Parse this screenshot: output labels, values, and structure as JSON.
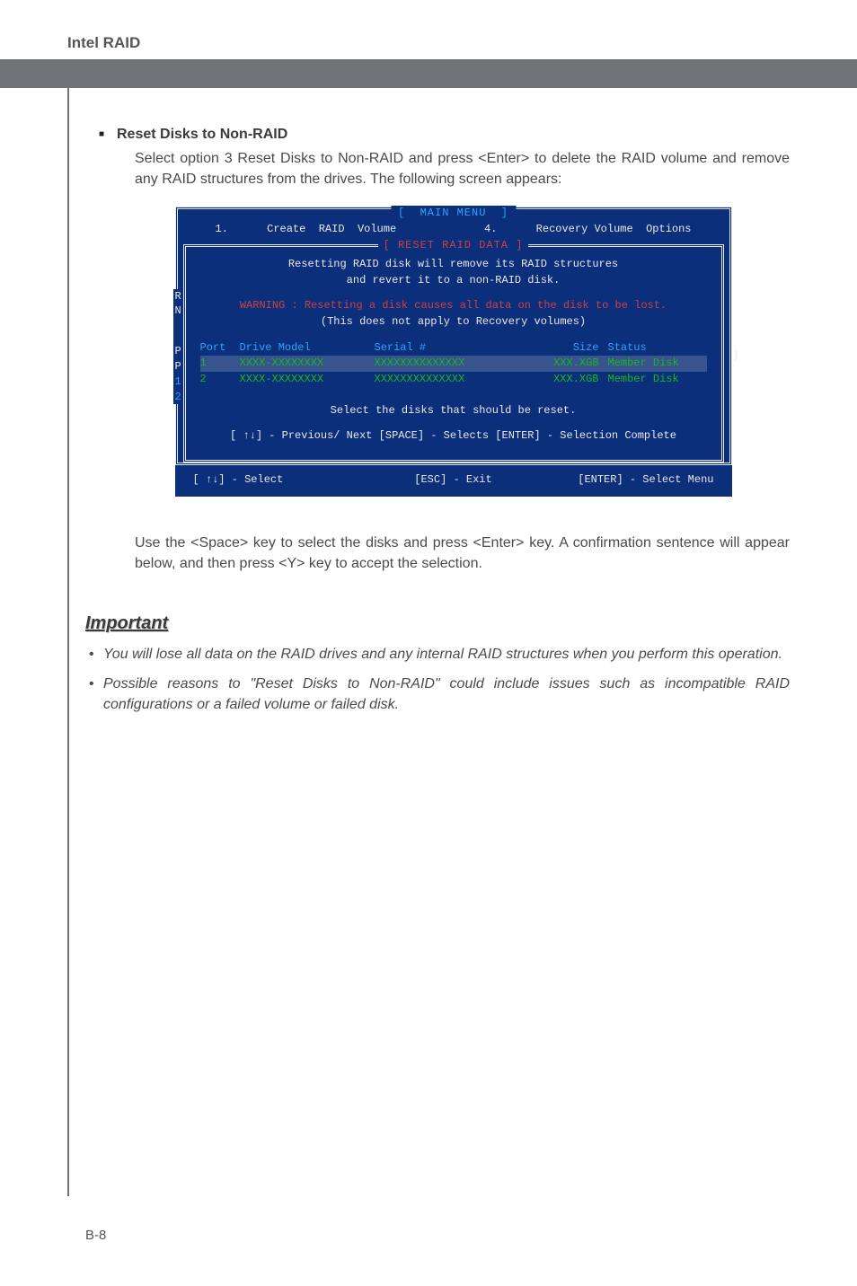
{
  "header": {
    "title": "Intel RAID"
  },
  "section": {
    "title": "Reset Disks to Non-RAID",
    "para1": "Select option 3 Reset Disks to Non-RAID and press <Enter> to delete the RAID volume and remove any RAID structures from the drives. The following screen appears:",
    "para2": "Use the <Space> key to select the disks and press <Enter> key. A confirmation sentence will appear below, and then press <Y> key to accept the selection."
  },
  "bios": {
    "main_menu": "MAIN MENU",
    "opt1_num": "1.",
    "opt1_label": "Create  RAID  Volume",
    "opt4_num": "4.",
    "opt4_label": "Recovery Volume  Options",
    "reset_label": "RESET  RAID  DATA",
    "line1": "Resetting  RAID  disk  will  remove  its  RAID  structures",
    "line2": "and  revert  it  to  a  non-RAID  disk.",
    "warn1": "WARNING : Resetting  a  disk  causes  all  data  on  the  disk  to  be  lost.",
    "warn2": "(This  does  not  apply  to  Recovery  volumes)",
    "headers": {
      "port": "Port",
      "drive": "Drive  Model",
      "serial": "Serial  #",
      "size": "Size",
      "status": "Status"
    },
    "rows": [
      {
        "port": "1",
        "drive": "XXXX-XXXXXXXX",
        "serial": "XXXXXXXXXXXXXX",
        "size": "XXX.XGB",
        "status": "Member Disk"
      },
      {
        "port": "2",
        "drive": "XXXX-XXXXXXXX",
        "serial": "XXXXXXXXXXXXXX",
        "size": "XXX.XGB",
        "status": "Member Disk"
      }
    ],
    "select_text": "Select  the  disks  that  should  be  reset.",
    "nav": "[ ↑↓] - Previous/ Next      [SPACE] - Selects      [ENTER] - Selection Complete",
    "bottom": {
      "left": "[ ↑↓] - Select",
      "mid": "[ESC] - Exit",
      "right": "[ENTER] - Select Menu"
    },
    "side": [
      "R",
      "N",
      "P",
      "P",
      "1",
      "2"
    ]
  },
  "important": {
    "title": "Important",
    "items": [
      "You will lose all data on the RAID drives and any internal RAID structures when you perform this operation.",
      "Possible reasons to \"Reset Disks to Non-RAID\" could include issues such as incompatible RAID configurations or a failed volume or failed disk."
    ]
  },
  "page_num": "B-8"
}
